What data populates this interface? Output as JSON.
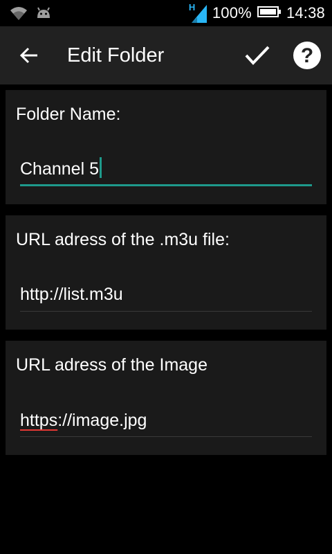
{
  "status_bar": {
    "network_type": "H",
    "battery_percent": "100%",
    "time": "14:38",
    "icons": [
      "wifi-icon",
      "android-debug-icon",
      "signal-icon",
      "battery-icon"
    ]
  },
  "app_bar": {
    "title": "Edit Folder",
    "background": "#212121",
    "icons": [
      "back-arrow-icon",
      "checkmark-icon",
      "help-icon"
    ]
  },
  "form": {
    "folder_name": {
      "label": "Folder Name:",
      "value": "Channel 5"
    },
    "m3u_url": {
      "label": "URL adress of the .m3u file:",
      "value": "http://list.m3u"
    },
    "image_url": {
      "label": "URL adress of the Image",
      "value_spellchecked": "https",
      "value_rest": "://image.jpg"
    }
  },
  "colors": {
    "accent": "#1e9a8c",
    "card_background": "#1a1a1a",
    "spellcheck": "#e53935"
  }
}
